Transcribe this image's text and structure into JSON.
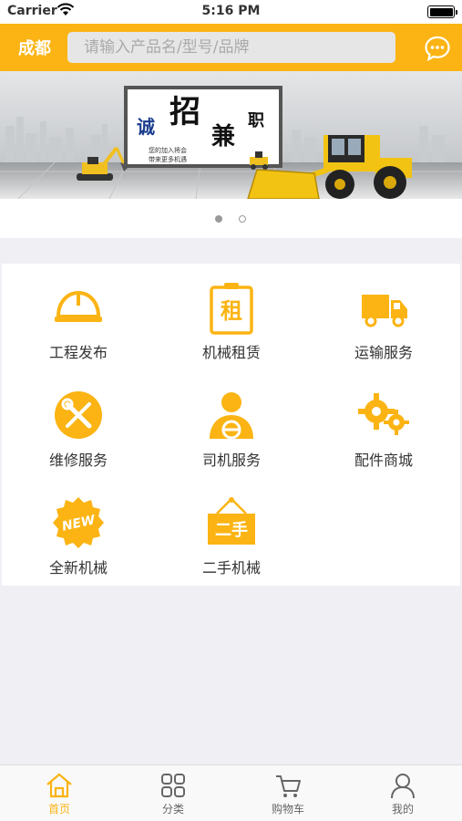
{
  "status_bar": {
    "carrier": "Carrier",
    "time": "5:16 PM"
  },
  "header": {
    "city": "成都",
    "search_placeholder": "请输入产品名/型号/品牌",
    "icon": "chat-bubble-icon"
  },
  "banner": {
    "headline_chars": [
      "诚",
      "招",
      "兼",
      "职"
    ],
    "sub_line1": "您的加入将会",
    "sub_line2": "带来更多机遇",
    "page_count": 2,
    "active_page": 1
  },
  "services": [
    {
      "label": "工程发布",
      "icon": "hardhat-icon"
    },
    {
      "label": "机械租赁",
      "icon": "rent-sign-icon",
      "icon_text": "租"
    },
    {
      "label": "运输服务",
      "icon": "truck-icon"
    },
    {
      "label": "维修服务",
      "icon": "wrench-screwdriver-icon"
    },
    {
      "label": "司机服务",
      "icon": "driver-icon"
    },
    {
      "label": "配件商城",
      "icon": "gears-icon"
    },
    {
      "label": "全新机械",
      "icon": "new-badge-icon",
      "icon_text": "NEW"
    },
    {
      "label": "二手机械",
      "icon": "secondhand-sign-icon",
      "icon_text": "二手"
    }
  ],
  "tabs": [
    {
      "label": "首页",
      "icon": "home-icon",
      "active": true
    },
    {
      "label": "分类",
      "icon": "grid-icon",
      "active": false
    },
    {
      "label": "购物车",
      "icon": "cart-icon",
      "active": false
    },
    {
      "label": "我的",
      "icon": "user-icon",
      "active": false
    }
  ],
  "colors": {
    "accent": "#fbb413",
    "background": "#efeff4"
  }
}
